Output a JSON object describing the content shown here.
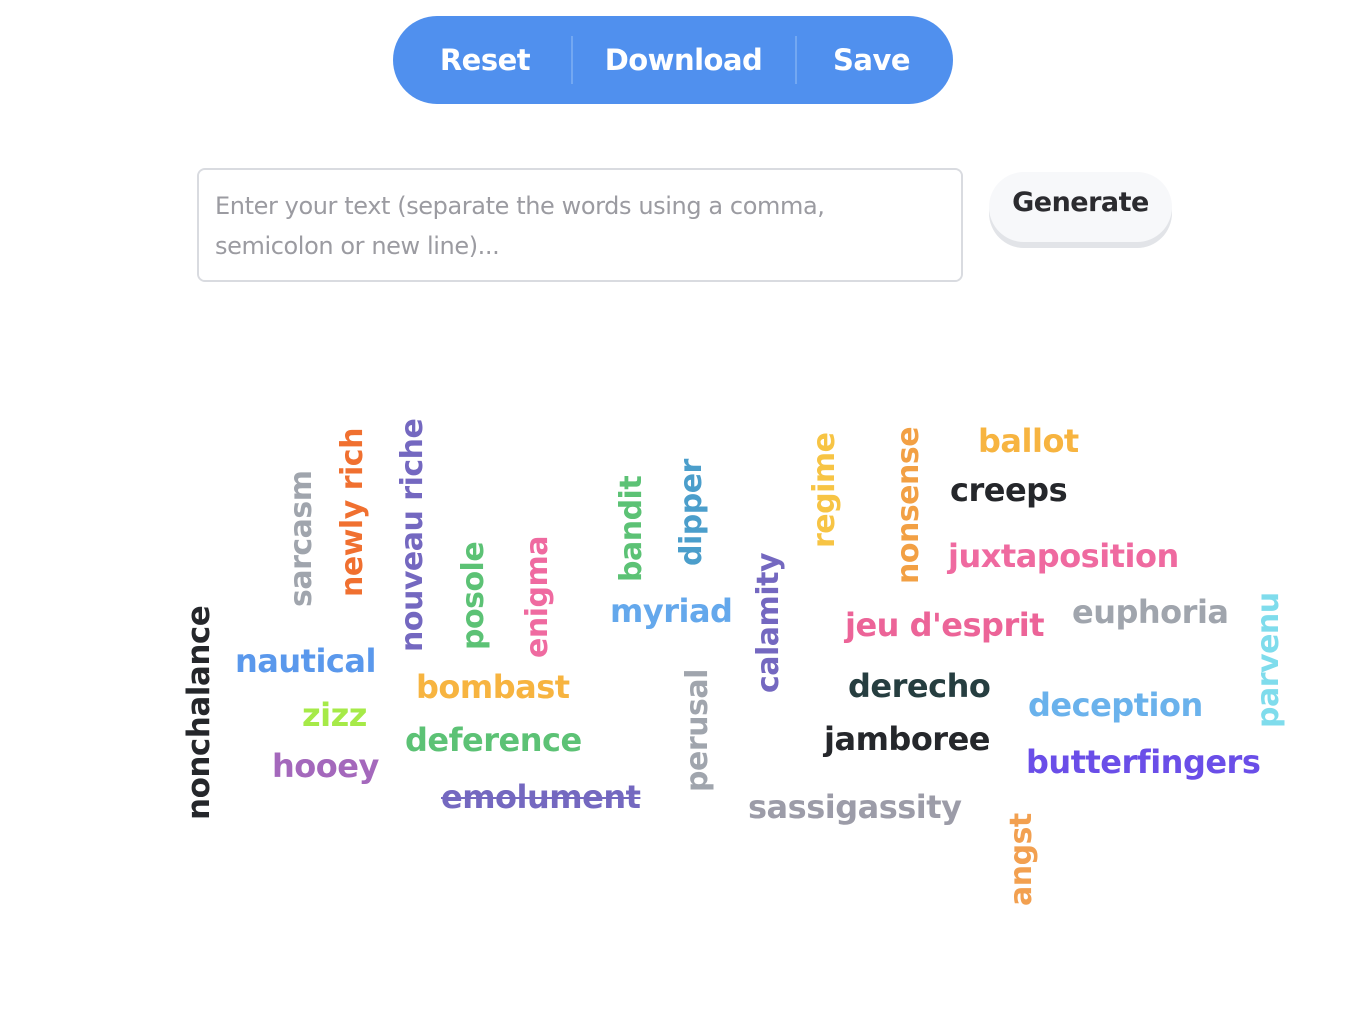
{
  "toolbar": {
    "reset_label": "Reset",
    "download_label": "Download",
    "save_label": "Save",
    "accent": "#5090ee"
  },
  "input": {
    "value": "",
    "placeholder": "Enter your text (separate the words using a comma, semicolon or new line)..."
  },
  "generate_label": "Generate",
  "word_cloud": [
    {
      "text": "nonchalance",
      "color": "#25272b",
      "orientation": "vertical"
    },
    {
      "text": "sarcasm",
      "color": "#a0a5ad",
      "orientation": "vertical"
    },
    {
      "text": "newly rich",
      "color": "#f07030",
      "orientation": "vertical"
    },
    {
      "text": "nouveau riche",
      "color": "#7468c0",
      "orientation": "vertical"
    },
    {
      "text": "posole",
      "color": "#5cc275",
      "orientation": "vertical"
    },
    {
      "text": "enigma",
      "color": "#ef6aa0",
      "orientation": "vertical"
    },
    {
      "text": "bandit",
      "color": "#5cc275",
      "orientation": "vertical"
    },
    {
      "text": "dipper",
      "color": "#4b9ecb",
      "orientation": "vertical"
    },
    {
      "text": "calamity",
      "color": "#7468c0",
      "orientation": "vertical"
    },
    {
      "text": "regime",
      "color": "#f7c444",
      "orientation": "vertical"
    },
    {
      "text": "nonsense",
      "color": "#f2a044",
      "orientation": "vertical"
    },
    {
      "text": "perusal",
      "color": "#a0a5ad",
      "orientation": "vertical"
    },
    {
      "text": "parvenu",
      "color": "#7fdcec",
      "orientation": "vertical"
    },
    {
      "text": "angst",
      "color": "#f2a050",
      "orientation": "vertical"
    },
    {
      "text": "nautical",
      "color": "#5a98ec",
      "orientation": "horizontal"
    },
    {
      "text": "zizz",
      "color": "#a6ea48",
      "orientation": "horizontal"
    },
    {
      "text": "hooey",
      "color": "#a468bc",
      "orientation": "horizontal"
    },
    {
      "text": "bombast",
      "color": "#f7b440",
      "orientation": "horizontal"
    },
    {
      "text": "deference",
      "color": "#5cc275",
      "orientation": "horizontal"
    },
    {
      "text": "emolument",
      "color": "#7468c0",
      "orientation": "horizontal"
    },
    {
      "text": "myriad",
      "color": "#64a8ec",
      "orientation": "horizontal"
    },
    {
      "text": "sassigassity",
      "color": "#9c9ca8",
      "orientation": "horizontal"
    },
    {
      "text": "ballot",
      "color": "#f7b440",
      "orientation": "horizontal"
    },
    {
      "text": "creeps",
      "color": "#25272b",
      "orientation": "horizontal"
    },
    {
      "text": "juxtaposition",
      "color": "#ef6aa0",
      "orientation": "horizontal"
    },
    {
      "text": "jeu d'esprit",
      "color": "#ec6498",
      "orientation": "horizontal"
    },
    {
      "text": "euphoria",
      "color": "#a0a5ad",
      "orientation": "horizontal"
    },
    {
      "text": "derecho",
      "color": "#263e40",
      "orientation": "horizontal"
    },
    {
      "text": "jamboree",
      "color": "#25272b",
      "orientation": "horizontal"
    },
    {
      "text": "deception",
      "color": "#6ab2ec",
      "orientation": "horizontal"
    },
    {
      "text": "butterfingers",
      "color": "#6a4ee8",
      "orientation": "horizontal"
    }
  ]
}
